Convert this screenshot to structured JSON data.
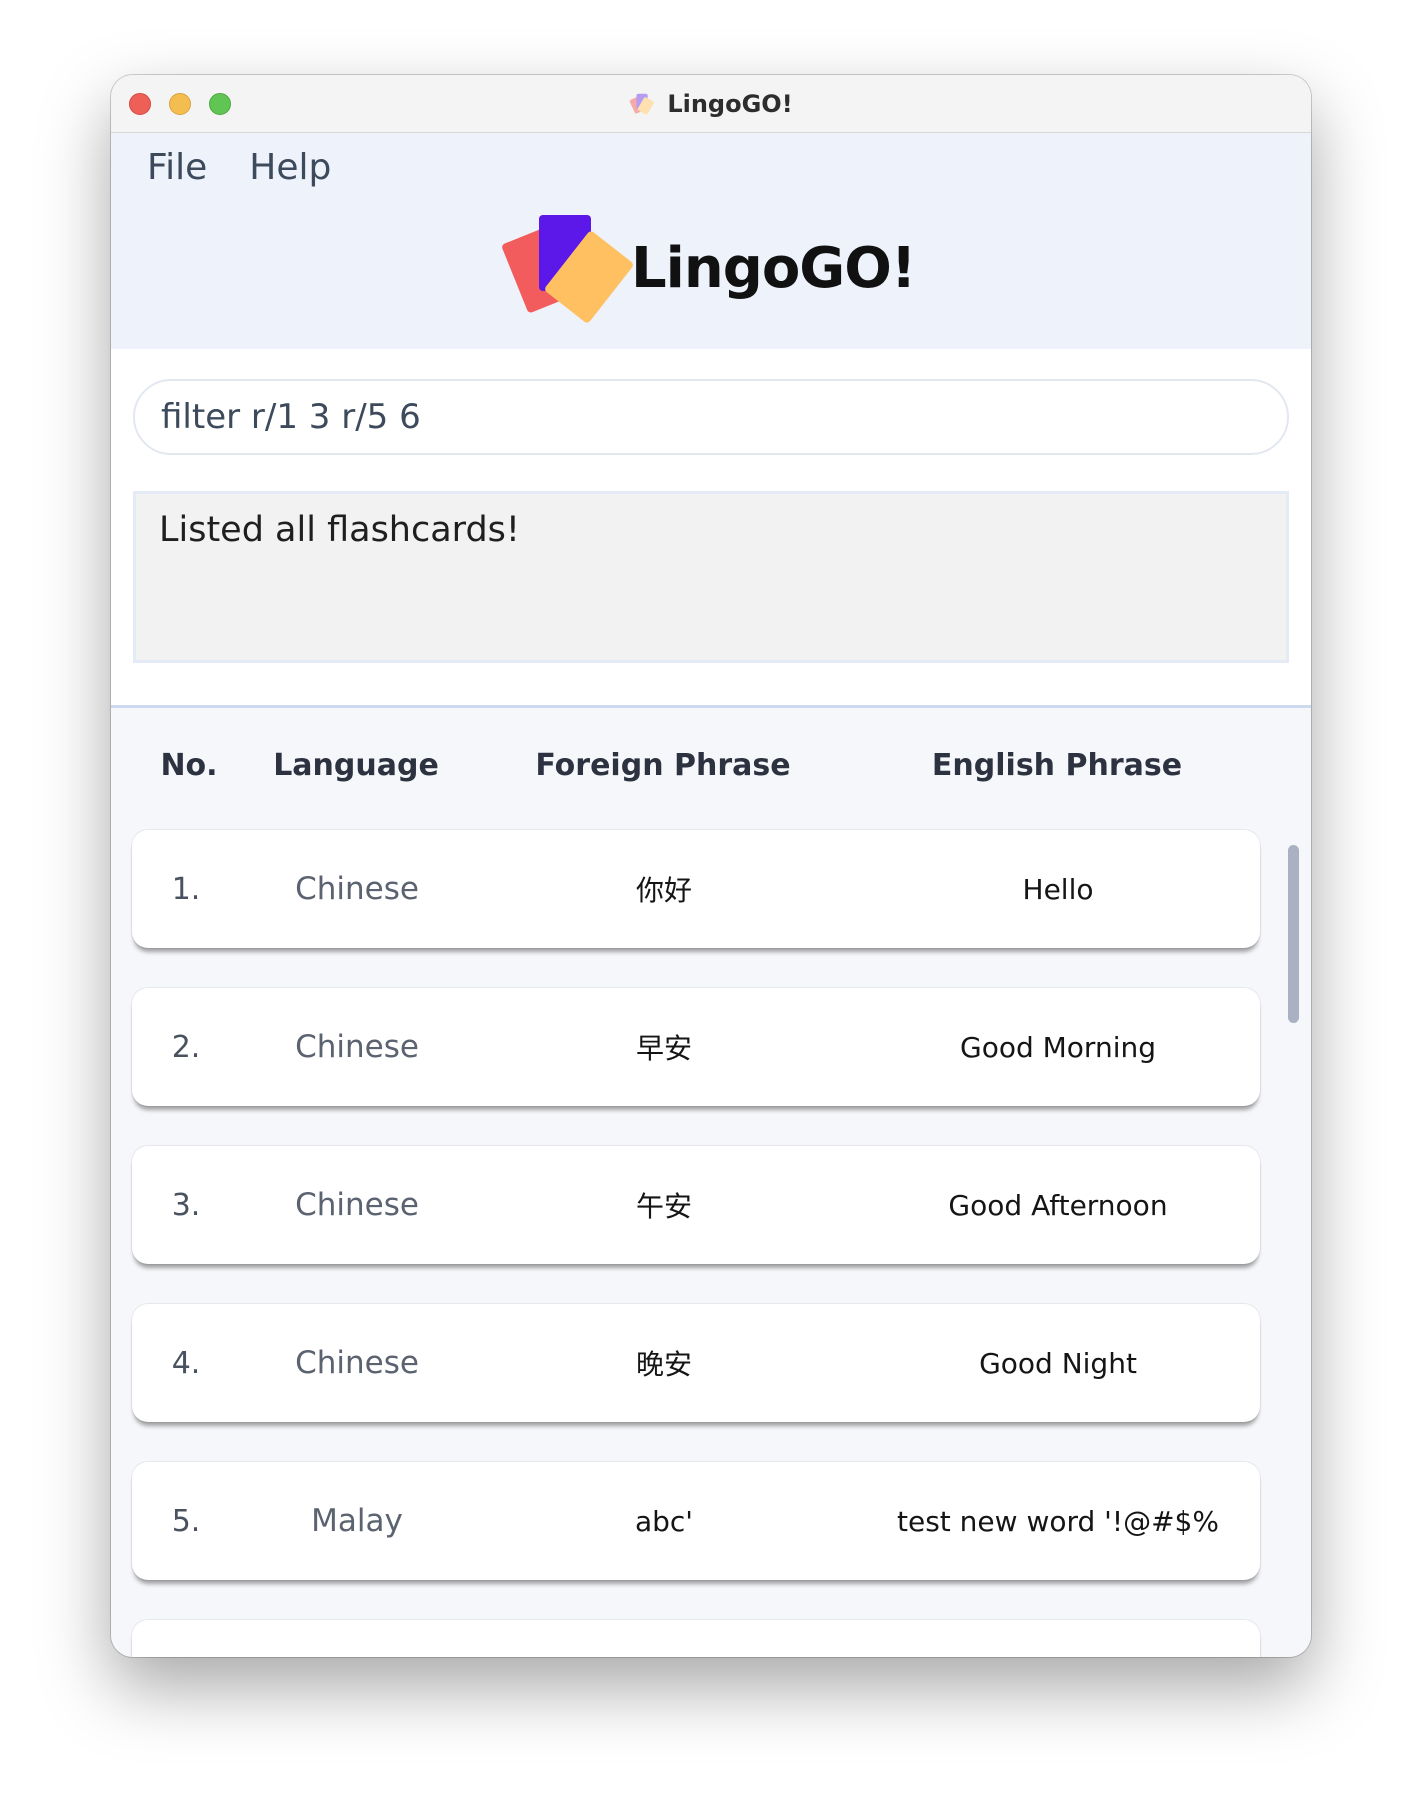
{
  "window": {
    "title": "LingoGO!"
  },
  "menu": {
    "items": [
      "File",
      "Help"
    ]
  },
  "brand": {
    "name": "LingoGO!",
    "colors": {
      "red": "#f25c5c",
      "purple": "#5b18e8",
      "orange": "#ffc062"
    }
  },
  "command": {
    "value": "filter r/1 3 r/5 6"
  },
  "result": {
    "message": "Listed all flashcards!"
  },
  "table": {
    "headers": {
      "no": "No.",
      "language": "Language",
      "foreign": "Foreign Phrase",
      "english": "English Phrase"
    },
    "rows": [
      {
        "no": "1.",
        "language": "Chinese",
        "foreign": "你好",
        "english": "Hello"
      },
      {
        "no": "2.",
        "language": "Chinese",
        "foreign": "早安",
        "english": "Good Morning"
      },
      {
        "no": "3.",
        "language": "Chinese",
        "foreign": "午安",
        "english": "Good Afternoon"
      },
      {
        "no": "4.",
        "language": "Chinese",
        "foreign": "晚安",
        "english": "Good Night"
      },
      {
        "no": "5.",
        "language": "Malay",
        "foreign": "abc'",
        "english": "test new word '!@#$%"
      },
      {
        "no": "",
        "language": "",
        "foreign": "",
        "english": ""
      }
    ]
  }
}
